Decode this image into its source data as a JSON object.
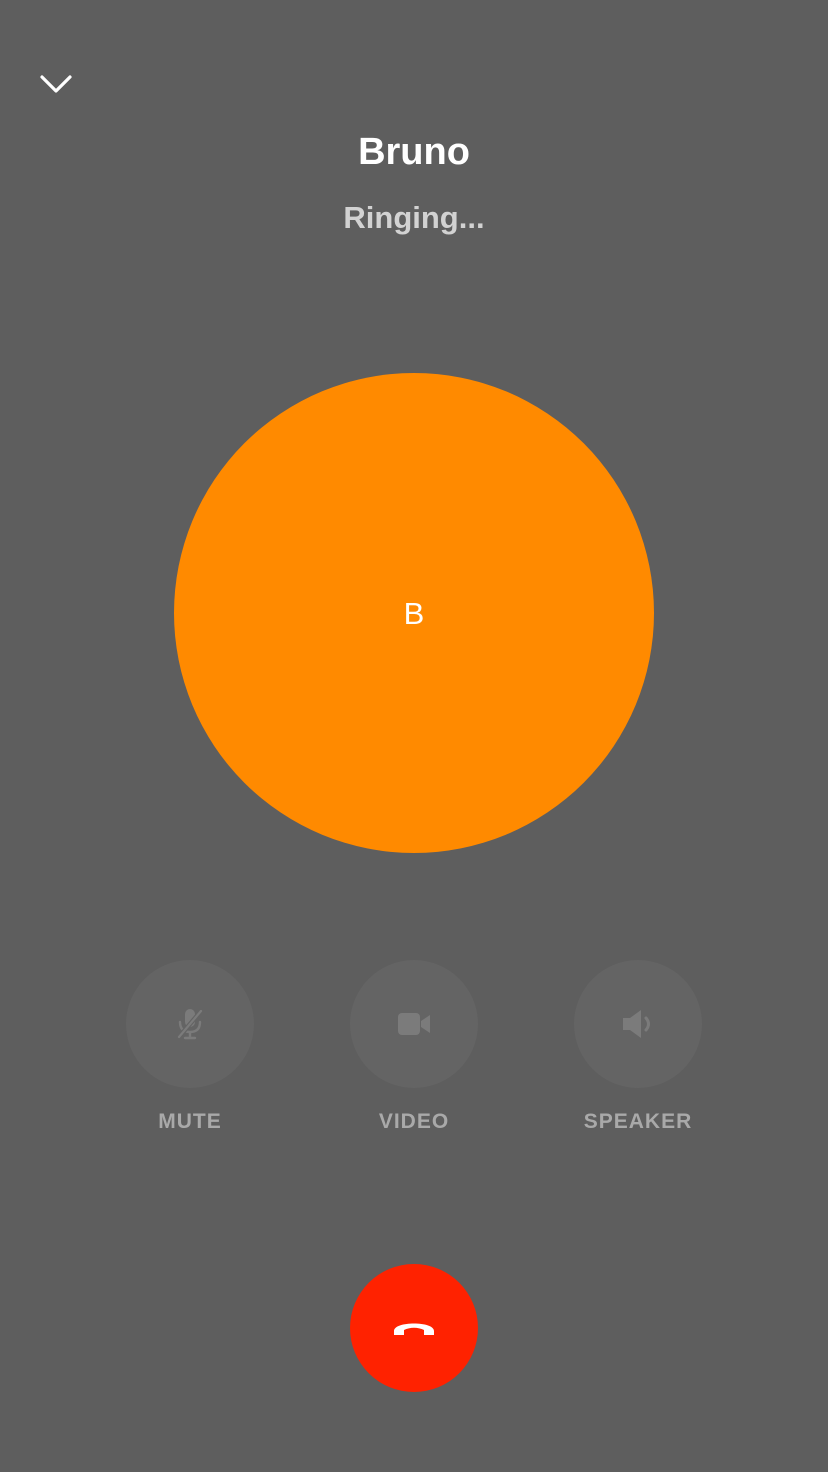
{
  "call": {
    "caller_name": "Bruno",
    "status": "Ringing...",
    "avatar_initial": "B",
    "avatar_color": "#ff8a00"
  },
  "controls": {
    "mute_label": "MUTE",
    "video_label": "VIDEO",
    "speaker_label": "SPEAKER"
  },
  "icons": {
    "collapse": "chevron-down-icon",
    "mute": "mic-off-icon",
    "video": "video-camera-icon",
    "speaker": "speaker-icon",
    "end_call": "phone-hangup-icon"
  },
  "colors": {
    "background": "#5e5e5e",
    "end_call": "#ff2200",
    "control_disabled": "#646464"
  }
}
